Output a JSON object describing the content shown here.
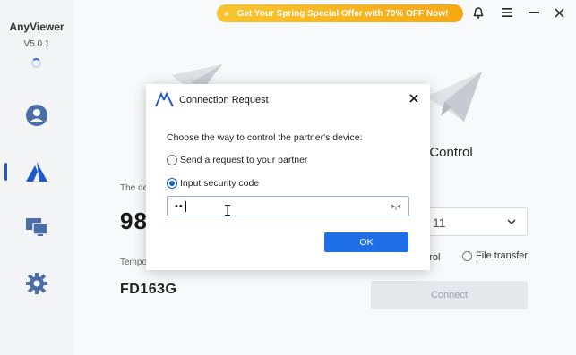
{
  "sidebar": {
    "app_name": "AnyViewer",
    "version": "V5.0.1",
    "items": [
      {
        "icon": "user-icon"
      },
      {
        "icon": "anyviewer-logo-icon",
        "active": true
      },
      {
        "icon": "monitor-icon"
      },
      {
        "icon": "gear-icon"
      }
    ]
  },
  "header": {
    "promo": "Get Your Spring Special Offer with 70% OFF Now!",
    "promo_arrows": "»",
    "icons": [
      "bell-icon",
      "menu-icon",
      "minimize-icon",
      "close-icon"
    ]
  },
  "left_panel": {
    "device_caption": "The de",
    "device_id": "98",
    "temp_caption": "Tempo",
    "temp_code": "FD163G"
  },
  "right_panel": {
    "title": "rt Control",
    "field_caption": ":",
    "select_value": "11",
    "option_control": "ntrol",
    "option_file": "File transfer",
    "connect_label": "Connect"
  },
  "dialog": {
    "title": "Connection Request",
    "question": "Choose the way to control the partner's device:",
    "options": [
      {
        "label": "Send a request to your partner",
        "selected": false
      },
      {
        "label": "Input security code",
        "selected": true
      }
    ],
    "code_value": "••",
    "ok_label": "OK"
  },
  "colors": {
    "accent": "#1e6fe6",
    "banner": "#f6b41f",
    "sidebar_bg": "#f3f4f6"
  }
}
